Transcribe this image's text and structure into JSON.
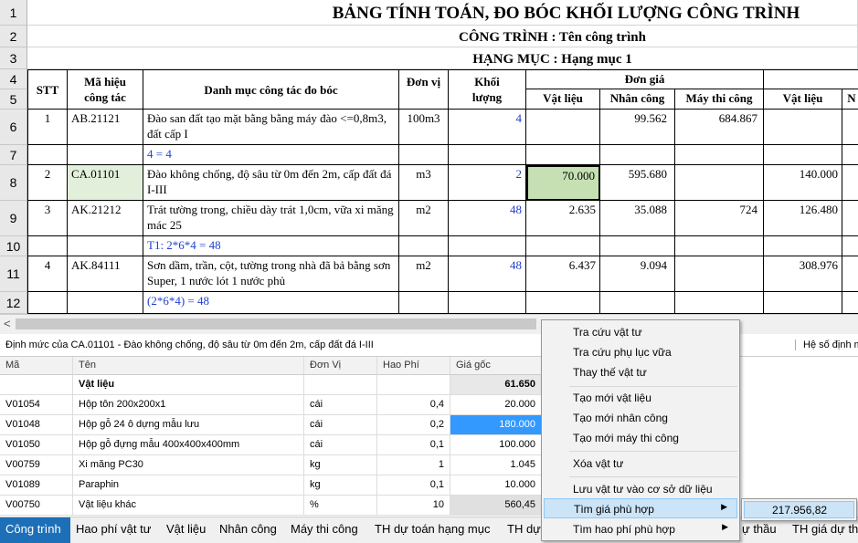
{
  "sheet": {
    "title": "BẢNG TÍNH TOÁN, ĐO BÓC KHỐI LƯỢNG CÔNG TRÌNH",
    "subtitle": "CÔNG TRÌNH : Tên công trình",
    "subtitle2": "HẠNG MỤC : Hạng mục 1",
    "row_numbers": [
      "1",
      "2",
      "3",
      "4",
      "5",
      "6",
      "7",
      "8",
      "9",
      "10",
      "11",
      "12"
    ],
    "headers": {
      "stt": "STT",
      "ma_hieu": "Mã hiệu công tác",
      "danh_muc": "Danh mục công tác đo bóc",
      "don_vi": "Đơn vị",
      "khoi_luong": "Khối lượng",
      "don_gia": "Đơn giá",
      "vat_lieu": "Vật liệu",
      "nhan_cong": "Nhân công",
      "may_thi_cong": "Máy thi công",
      "vat_lieu2": "Vật liệu",
      "next": "N"
    },
    "rows": [
      {
        "stt": "1",
        "code": "AB.21121",
        "desc": "Đào san đất tạo mặt bằng bằng máy đào <=0,8m3, đất cấp I",
        "unit": "100m3",
        "qty": "4",
        "vl": "",
        "nc": "99.562",
        "mtc": "684.867",
        "vl2": ""
      },
      {
        "formula": "4 = 4"
      },
      {
        "stt": "2",
        "code": "CA.01101",
        "desc": "Đào không chống, độ sâu từ 0m đến 2m, cấp đất đá I-III",
        "unit": "m3",
        "qty": "2",
        "vl": "70.000",
        "nc": "595.680",
        "mtc": "",
        "vl2": "140.000"
      },
      {
        "stt": "3",
        "code": "AK.21212",
        "desc": "Trát tường trong, chiều dày trát 1,0cm, vữa xi măng mác 25",
        "unit": "m2",
        "qty": "48",
        "vl": "2.635",
        "nc": "35.088",
        "mtc": "724",
        "vl2": "126.480"
      },
      {
        "formula": "T1: 2*6*4 = 48"
      },
      {
        "stt": "4",
        "code": "AK.84111",
        "desc": "Sơn dầm, trần, cột, tường trong nhà đã bả bằng sơn Super, 1 nước lót 1 nước phủ",
        "unit": "m2",
        "qty": "48",
        "vl": "6.437",
        "nc": "9.094",
        "mtc": "",
        "vl2": "308.976"
      },
      {
        "formula": "(2*6*4) = 48"
      }
    ]
  },
  "infobar": {
    "text": "Định mức của CA.01101 - Đào không chống, độ sâu từ 0m đến 2m, cấp đất đá I-III",
    "right": "Hệ số định m"
  },
  "grid": {
    "headers": [
      "Mã",
      "Tên",
      "Đơn Vị",
      "Hao Phí",
      "Giá gốc"
    ],
    "group": {
      "name": "Vật liệu",
      "total": "61.650"
    },
    "rows": [
      {
        "code": "V01054",
        "name": "Hộp tôn 200x200x1",
        "unit": "cái",
        "hp": "0,4",
        "price": "20.000"
      },
      {
        "code": "V01048",
        "name": "Hộp gỗ 24 ô dựng mẫu lưu",
        "unit": "cái",
        "hp": "0,2",
        "price": "180.000"
      },
      {
        "code": "V01050",
        "name": "Hộp gỗ đựng mẫu 400x400x400mm",
        "unit": "cái",
        "hp": "0,1",
        "price": "100.000"
      },
      {
        "code": "V00759",
        "name": "Xi măng PC30",
        "unit": "kg",
        "hp": "1",
        "price": "1.045"
      },
      {
        "code": "V01089",
        "name": "Paraphin",
        "unit": "kg",
        "hp": "0,1",
        "price": "10.000"
      },
      {
        "code": "V00750",
        "name": "Vật liệu khác",
        "unit": "%",
        "hp": "10",
        "price": "560,45"
      }
    ]
  },
  "menu": {
    "items": [
      "Tra cứu vật tư",
      "Tra cứu phụ lục vữa",
      "Thay thế vật tư",
      "Tạo mới vật liệu",
      "Tạo mới nhân công",
      "Tạo mới máy thi công",
      "Xóa vật tư",
      "Lưu vật tư vào cơ sở dữ liệu",
      "Tìm giá phù hợp",
      "Tìm hao phí phù hợp"
    ],
    "submenu_value": "217.956,82"
  },
  "tabs": [
    "Công trình",
    "Hao phí vật tư",
    "Vật liệu",
    "Nhân công",
    "Máy thi công",
    "TH dự toán hạng mục",
    "TH dự",
    "ự thầu",
    "TH giá dự th"
  ],
  "colors": {
    "accent": "#1d6fb8",
    "selected_cell": "#c6e0b4",
    "highlight": "#3399ff",
    "blue_text": "#1f3fd0"
  }
}
